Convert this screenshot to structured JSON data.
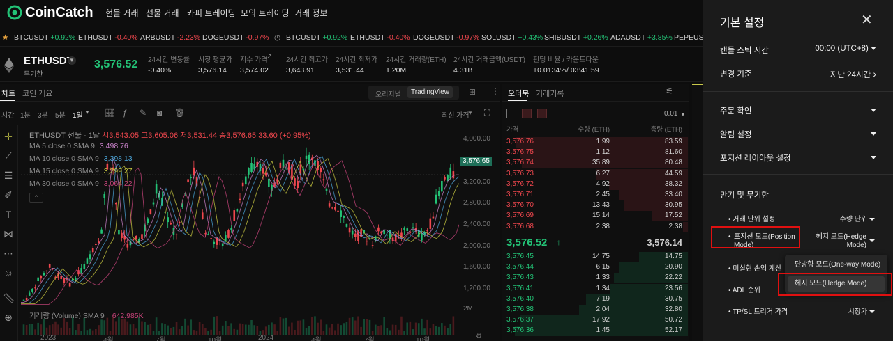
{
  "brand": {
    "name": "CoinCatch",
    "accent": "#23c276",
    "down_color": "#f0474e"
  },
  "nav": [
    "현물 거래",
    "선물 거래",
    "카피 트레이딩",
    "모의 트레이딩",
    "거래 정보"
  ],
  "ticker": [
    {
      "sym": "BTCUSDT",
      "chg": "+0.92%",
      "dir": "up"
    },
    {
      "sym": "ETHUSDT",
      "chg": "-0.40%",
      "dir": "dn"
    },
    {
      "sym": "ARBUSDT",
      "chg": "-2.23%",
      "dir": "dn"
    },
    {
      "sym": "DOGEUSDT",
      "chg": "-0.97%",
      "dir": "dn"
    },
    {
      "sym": "BTCUSDT",
      "chg": "+0.92%",
      "dir": "up"
    },
    {
      "sym": "ETHUSDT",
      "chg": "-0.40%",
      "dir": "dn"
    },
    {
      "sym": "DOGEUSDT",
      "chg": "-0.97%",
      "dir": "dn"
    },
    {
      "sym": "SOLUSDT",
      "chg": "+0.43%",
      "dir": "up"
    },
    {
      "sym": "SHIBUSDT",
      "chg": "+0.26%",
      "dir": "up"
    },
    {
      "sym": "ADAUSDT",
      "chg": "+3.85%",
      "dir": "up"
    },
    {
      "sym": "PEPEUSD",
      "chg": "",
      "dir": "up"
    }
  ],
  "pair": {
    "symbol": "ETHUSDT",
    "type": "무기한",
    "price": "3,576.52",
    "stats": [
      {
        "label": "24시간 변동률",
        "value": "-0.40%",
        "dir": "dn"
      },
      {
        "label": "시장 평균가",
        "value": "3,576.14",
        "dir": "up"
      },
      {
        "label": "지수 가격",
        "value": "3,574.02",
        "dir": "none"
      },
      {
        "label": "24시간 최고가",
        "value": "3,643.91",
        "dir": "none"
      },
      {
        "label": "24시간 최저가",
        "value": "3,531.44",
        "dir": "none"
      },
      {
        "label": "24시간 거래량(ETH)",
        "value": "1.20M",
        "dir": "none"
      },
      {
        "label": "24시간 거래금액(USDT)",
        "value": "4.31B",
        "dir": "none"
      },
      {
        "label": "펀딩 비율 / 카운트다운",
        "value": "+0.0134%",
        "value2": "/ 03:41:59",
        "dir": "up"
      }
    ]
  },
  "chart": {
    "tabs": [
      "차트",
      "코인 개요"
    ],
    "views": [
      "오리지널",
      "TradingView"
    ],
    "intervals": [
      "시간",
      "1분",
      "3분",
      "5분",
      "1일"
    ],
    "price_type": "최신 가격",
    "title": "ETHUSDT 선물 · 1날",
    "ohlc": {
      "o": "시3,543.05",
      "h": "고3,605.06",
      "l": "저3,531.44",
      "c": "종3,576.65",
      "chg": "33.60 (+0.95%)"
    },
    "ma": [
      {
        "label": "MA 5 close 0 SMA 9",
        "value": "3,498.76",
        "color": "#c780c7"
      },
      {
        "label": "MA 10 close 0 SMA 9",
        "value": "3,398.13",
        "color": "#4aa3d6"
      },
      {
        "label": "MA 15 close 0 SMA 9",
        "value": "3,299.27",
        "color": "#c6c640"
      },
      {
        "label": "MA 30 close 0 SMA 9",
        "value": "3,064.22",
        "color": "#c6437a"
      }
    ],
    "volume": {
      "label": "거래량 (Volume) SMA 9",
      "value": "642.985K",
      "axis": "2M"
    },
    "price_axis": [
      "4,000.00",
      "3,200.00",
      "2,800.00",
      "2,400.00",
      "2,000.00",
      "1,600.00",
      "1,200.00"
    ],
    "last_price": "3,576.65",
    "x_axis": [
      "2023",
      "4월",
      "7월",
      "10월",
      "2024",
      "4월",
      "7월",
      "10월"
    ]
  },
  "orderbook": {
    "tabs": [
      "오더북",
      "거래기록"
    ],
    "precision": "0.01",
    "headers": [
      "가격",
      "수량 (ETH)",
      "총량 (ETH)"
    ],
    "asks": [
      [
        "3,576.76",
        "1.99",
        "83.59"
      ],
      [
        "3,576.75",
        "1.12",
        "81.60"
      ],
      [
        "3,576.74",
        "35.89",
        "80.48"
      ],
      [
        "3,576.73",
        "6.27",
        "44.59"
      ],
      [
        "3,576.72",
        "4.92",
        "38.32"
      ],
      [
        "3,576.71",
        "2.45",
        "33.40"
      ],
      [
        "3,576.70",
        "13.43",
        "30.95"
      ],
      [
        "3,576.69",
        "15.14",
        "17.52"
      ],
      [
        "3,576.68",
        "2.38",
        "2.38"
      ]
    ],
    "mid": {
      "price": "3,576.52",
      "mark": "3,576.14"
    },
    "bids": [
      [
        "3,576.45",
        "14.75",
        "14.75"
      ],
      [
        "3,576.44",
        "6.15",
        "20.90"
      ],
      [
        "3,576.43",
        "1.33",
        "22.22"
      ],
      [
        "3,576.41",
        "1.34",
        "23.56"
      ],
      [
        "3,576.40",
        "7.19",
        "30.75"
      ],
      [
        "3,576.38",
        "2.04",
        "32.80"
      ],
      [
        "3,576.37",
        "17.92",
        "50.72"
      ],
      [
        "3,576.36",
        "1.45",
        "52.17"
      ]
    ]
  },
  "settings": {
    "title": "기본 설정",
    "rows": [
      {
        "label": "캔들 스틱 시간",
        "value": "00:00 (UTC+8)"
      },
      {
        "label": "변경 기준",
        "value": "지난 24시간"
      }
    ],
    "sections": [
      "주문 확인",
      "알림 설정",
      "포지션 레이아웃 설정"
    ],
    "futures_title": "만기 및 무기한",
    "futures": [
      {
        "label": "거래 단위 설정",
        "value": "수량 단위"
      },
      {
        "label": "포지션 모드(Position Mode)",
        "value": "헤지 모드(Hedge Mode)"
      },
      {
        "label": "미실현 손익 계산",
        "value": ""
      },
      {
        "label": "ADL 순위",
        "value": ""
      },
      {
        "label": "TP/SL 트리거 가격",
        "value": "시장가"
      }
    ],
    "dropdown": [
      "단방향 모드(One-way Mode)",
      "헤지 모드(Hedge Mode)"
    ]
  }
}
